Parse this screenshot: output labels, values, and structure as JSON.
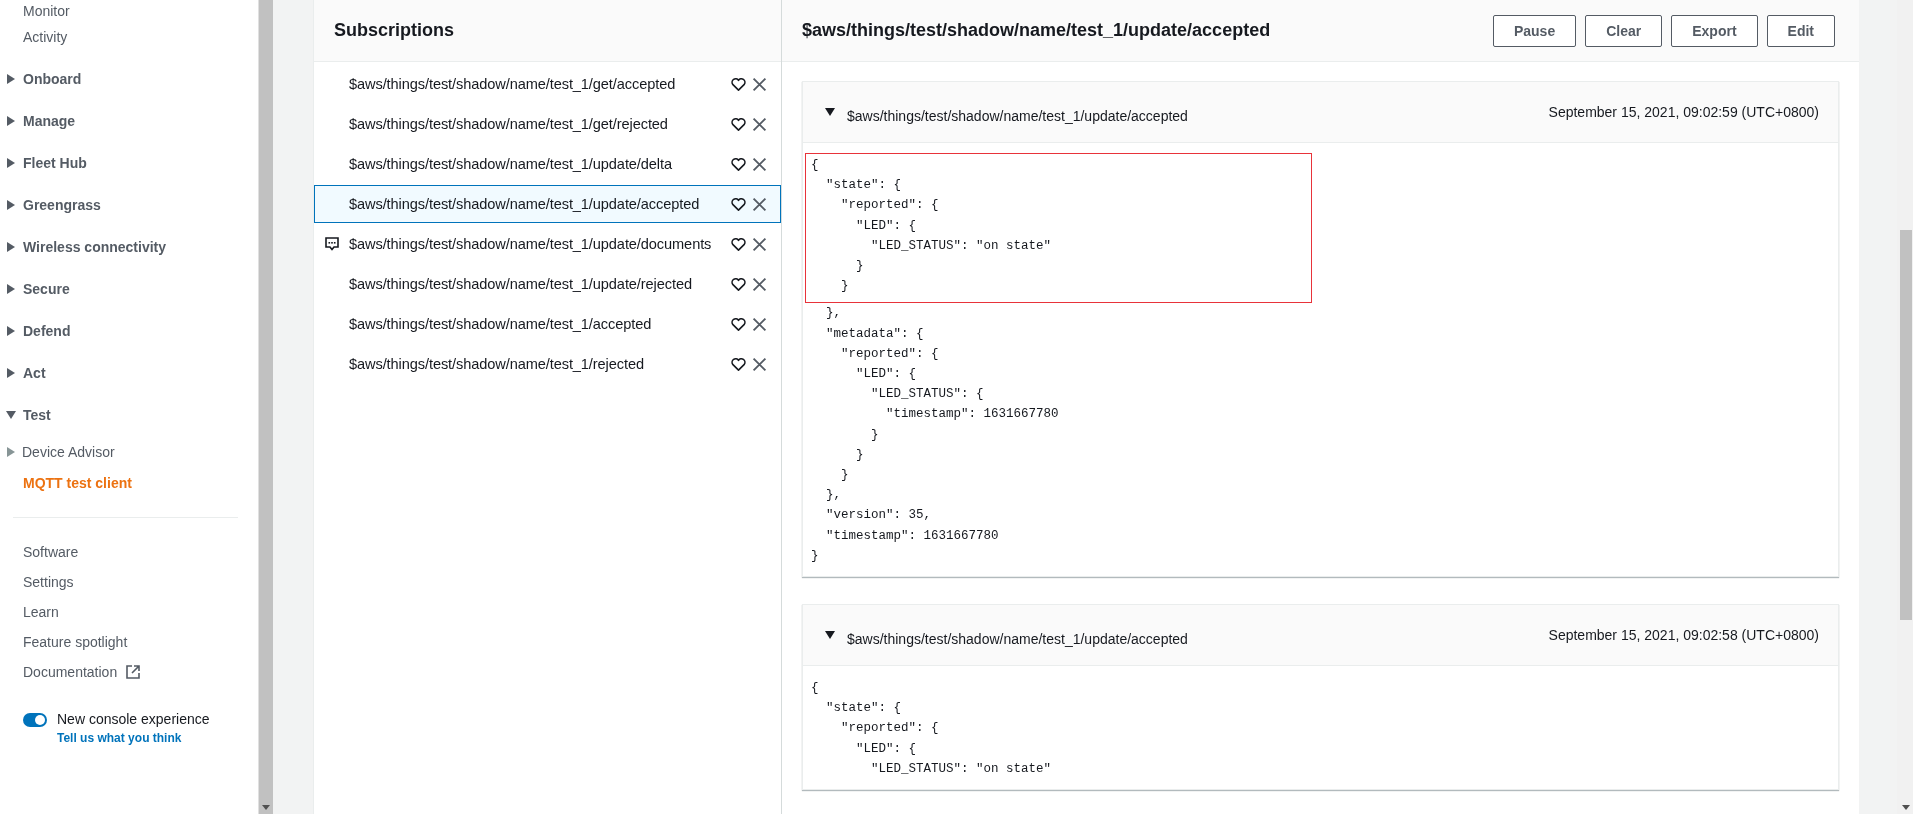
{
  "sidebar": {
    "items": [
      {
        "kind": "link",
        "label": "Monitor",
        "selected": false
      },
      {
        "kind": "link",
        "label": "Activity",
        "selected": false
      },
      {
        "kind": "section",
        "label": "Onboard",
        "expanded": false
      },
      {
        "kind": "section",
        "label": "Manage",
        "expanded": false
      },
      {
        "kind": "section",
        "label": "Fleet Hub",
        "expanded": false
      },
      {
        "kind": "section",
        "label": "Greengrass",
        "expanded": false
      },
      {
        "kind": "section",
        "label": "Wireless connectivity",
        "expanded": false
      },
      {
        "kind": "section",
        "label": "Secure",
        "expanded": false
      },
      {
        "kind": "section",
        "label": "Defend",
        "expanded": false
      },
      {
        "kind": "section",
        "label": "Act",
        "expanded": false
      },
      {
        "kind": "section",
        "label": "Test",
        "expanded": true
      },
      {
        "kind": "group",
        "label": "Device Advisor",
        "expanded": false
      },
      {
        "kind": "link",
        "label": "MQTT test client",
        "selected": true
      }
    ],
    "footer_items": [
      {
        "label": "Software",
        "external": false
      },
      {
        "label": "Settings",
        "external": false
      },
      {
        "label": "Learn",
        "external": false
      },
      {
        "label": "Feature spotlight",
        "external": false
      },
      {
        "label": "Documentation",
        "external": true
      }
    ],
    "toggle": {
      "label": "New console experience",
      "on": true,
      "link": "Tell us what you think"
    }
  },
  "subscriptions": {
    "title": "Subscriptions",
    "items": [
      {
        "topic": "$aws/things/test/shadow/name/test_1/get/accepted",
        "selected": false,
        "unread": false
      },
      {
        "topic": "$aws/things/test/shadow/name/test_1/get/rejected",
        "selected": false,
        "unread": false
      },
      {
        "topic": "$aws/things/test/shadow/name/test_1/update/delta",
        "selected": false,
        "unread": false
      },
      {
        "topic": "$aws/things/test/shadow/name/test_1/update/accepted",
        "selected": true,
        "unread": false
      },
      {
        "topic": "$aws/things/test/shadow/name/test_1/update/documents",
        "selected": false,
        "unread": true
      },
      {
        "topic": "$aws/things/test/shadow/name/test_1/update/rejected",
        "selected": false,
        "unread": false
      },
      {
        "topic": "$aws/things/test/shadow/name/test_1/accepted",
        "selected": false,
        "unread": false
      },
      {
        "topic": "$aws/things/test/shadow/name/test_1/rejected",
        "selected": false,
        "unread": false
      }
    ]
  },
  "messages_panel": {
    "title": "$aws/things/test/shadow/name/test_1/update/accepted",
    "buttons": [
      "Pause",
      "Clear",
      "Export",
      "Edit"
    ],
    "messages": [
      {
        "topic": "$aws/things/test/shadow/name/test_1/update/accepted",
        "time": "September 15, 2021, 09:02:59 (UTC+0800)",
        "expanded": true,
        "lines": [
          {
            "text": "{",
            "highlighted": true
          },
          {
            "text": "  \"state\": {",
            "highlighted": true
          },
          {
            "text": "    \"reported\": {",
            "highlighted": true
          },
          {
            "text": "      \"LED\": {",
            "highlighted": true
          },
          {
            "text": "        \"LED_STATUS\": \"on state\"",
            "highlighted": true
          },
          {
            "text": "      }",
            "highlighted": true
          },
          {
            "text": "    }",
            "highlighted": true
          },
          {
            "text": "  },",
            "highlighted": false
          },
          {
            "text": "  \"metadata\": {",
            "highlighted": false
          },
          {
            "text": "    \"reported\": {",
            "highlighted": false
          },
          {
            "text": "      \"LED\": {",
            "highlighted": false
          },
          {
            "text": "        \"LED_STATUS\": {",
            "highlighted": false
          },
          {
            "text": "          \"timestamp\": 1631667780",
            "highlighted": false
          },
          {
            "text": "        }",
            "highlighted": false
          },
          {
            "text": "      }",
            "highlighted": false
          },
          {
            "text": "    }",
            "highlighted": false
          },
          {
            "text": "  },",
            "highlighted": false
          },
          {
            "text": "  \"version\": 35,",
            "highlighted": false
          },
          {
            "text": "  \"timestamp\": 1631667780",
            "highlighted": false
          },
          {
            "text": "}",
            "highlighted": false
          }
        ]
      },
      {
        "topic": "$aws/things/test/shadow/name/test_1/update/accepted",
        "time": "September 15, 2021, 09:02:58 (UTC+0800)",
        "expanded": true,
        "lines": [
          {
            "text": "{",
            "highlighted": false
          },
          {
            "text": "  \"state\": {",
            "highlighted": false
          },
          {
            "text": "    \"reported\": {",
            "highlighted": false
          },
          {
            "text": "      \"LED\": {",
            "highlighted": false
          },
          {
            "text": "        \"LED_STATUS\": \"on state\"",
            "highlighted": false
          }
        ]
      }
    ]
  }
}
